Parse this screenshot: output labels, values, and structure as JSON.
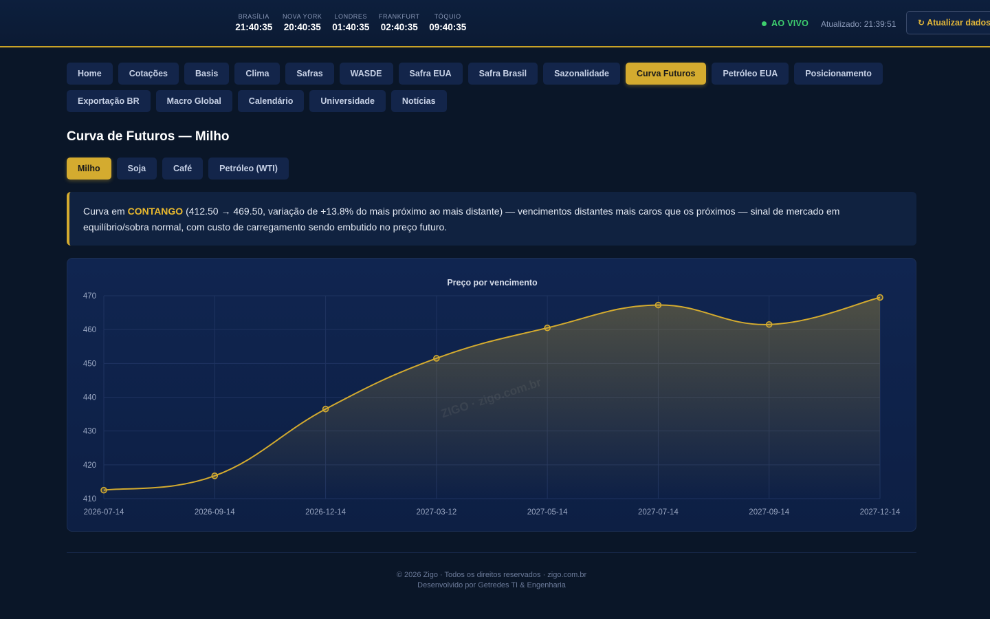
{
  "header": {
    "clocks": [
      {
        "city": "BRASÍLIA",
        "time": "21:40:35"
      },
      {
        "city": "NOVA YORK",
        "time": "20:40:35"
      },
      {
        "city": "LONDRES",
        "time": "01:40:35"
      },
      {
        "city": "FRANKFURT",
        "time": "02:40:35"
      },
      {
        "city": "TÓQUIO",
        "time": "09:40:35"
      }
    ],
    "live_label": "AO VIVO",
    "updated_label": "Atualizado: 21:39:51",
    "refresh_label": "Atualizar dados"
  },
  "nav": {
    "row1": [
      "Home",
      "Cotações",
      "Basis",
      "Clima",
      "Safras",
      "WASDE",
      "Safra EUA",
      "Safra Brasil",
      "Sazonalidade",
      "Curva Futuros",
      "Petróleo EUA",
      "Posicionamento"
    ],
    "row2": [
      "Exportação BR",
      "Macro Global",
      "Calendário",
      "Universidade",
      "Notícias"
    ],
    "active": "Curva Futuros"
  },
  "page_title": "Curva de Futuros — Milho",
  "subtabs": {
    "items": [
      "Milho",
      "Soja",
      "Café",
      "Petróleo (WTI)"
    ],
    "active": "Milho"
  },
  "info": {
    "prefix": "Curva em ",
    "highlight": "CONTANGO",
    "text": " (412.50 → 469.50, variação de +13.8% do mais próximo ao mais distante) — vencimentos distantes mais caros que os próximos — sinal de mercado em equilíbrio/sobra normal, com custo de carregamento sendo embutido no preço futuro."
  },
  "chart_data": {
    "type": "area",
    "title": "Preço por vencimento",
    "x": [
      "2026-07-14",
      "2026-09-14",
      "2026-12-14",
      "2027-03-12",
      "2027-05-14",
      "2027-07-14",
      "2027-09-14",
      "2027-12-14"
    ],
    "series": [
      {
        "values": [
          412.5,
          416.75,
          436.5,
          451.5,
          460.5,
          467.25,
          461.5,
          469.5
        ]
      }
    ],
    "ylim": [
      410,
      470
    ],
    "yticks": [
      410,
      420,
      430,
      440,
      450,
      460,
      470
    ],
    "grid": true,
    "legend": "none",
    "line_color": "#d4ab2f",
    "watermark": "ZIGO · zigo.com.br"
  },
  "footer": {
    "line1": "© 2026 Zigo · Todos os direitos reservados · zigo.com.br",
    "line2": "Desenvolvido por Getredes TI & Engenharia"
  }
}
